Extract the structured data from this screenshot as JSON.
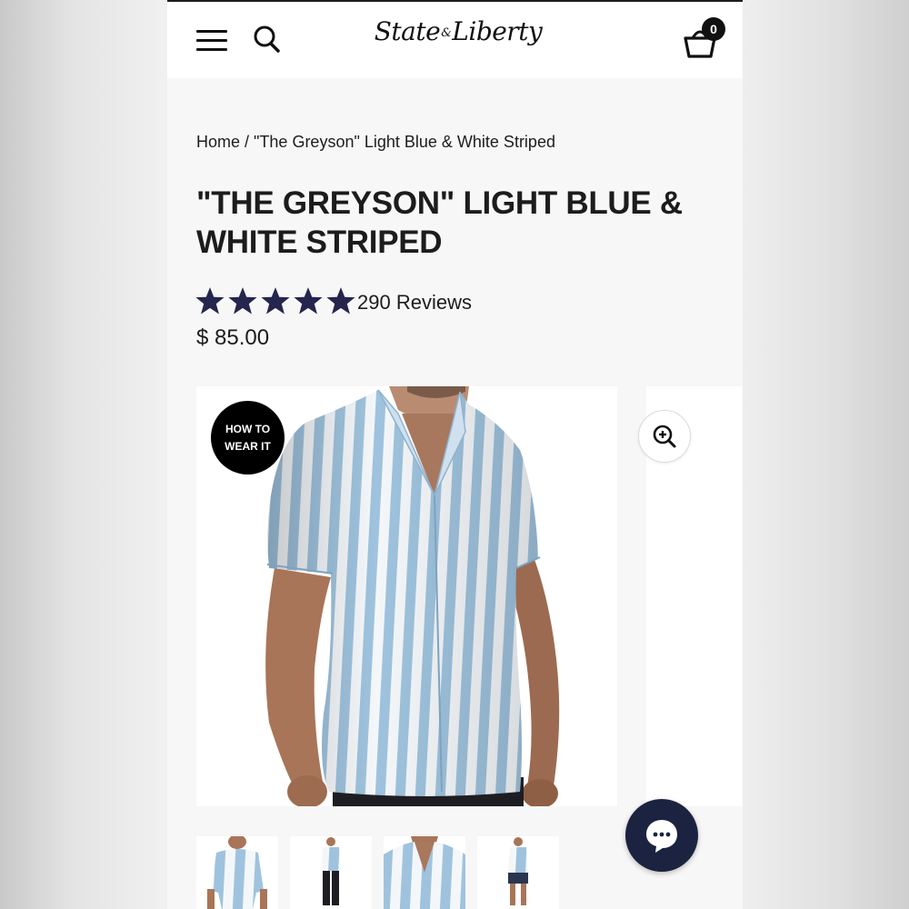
{
  "header": {
    "logo_text_1": "State",
    "logo_amp": "&",
    "logo_text_2": "Liberty",
    "cart_count": "0"
  },
  "breadcrumb": {
    "home": "Home",
    "separator": " / ",
    "current": "\"The Greyson\" Light Blue & White Striped"
  },
  "product": {
    "title": "\"THE GREYSON\" LIGHT BLUE & WHITE STRIPED",
    "rating": 5,
    "rating_max": 5,
    "reviews_label": "290 Reviews",
    "price": "$ 85.00",
    "badge": "HOW TO WEAR IT"
  },
  "colors": {
    "accent_navy": "#1b2340",
    "star_color": "#25254d",
    "stripe_blue": "#9fc3de",
    "text": "#1c1c1c"
  },
  "icons": [
    "menu-icon",
    "search-icon",
    "cart-icon",
    "zoom-in-icon",
    "chat-icon",
    "star-icon"
  ]
}
